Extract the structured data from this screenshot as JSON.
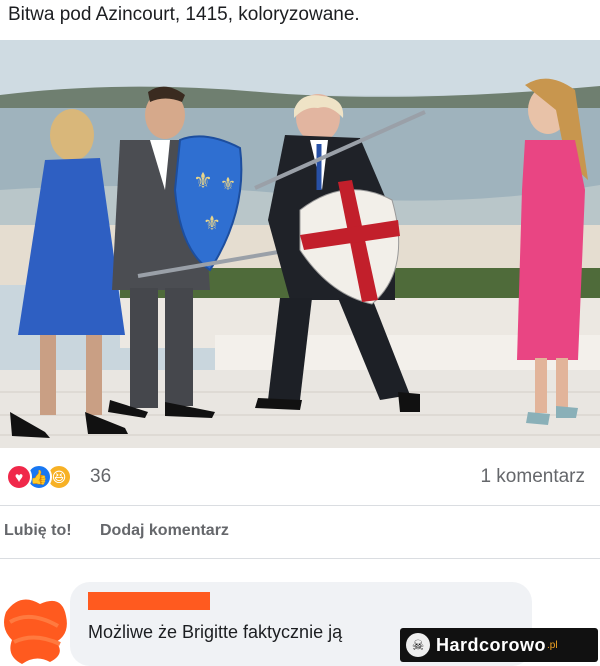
{
  "post": {
    "title": "Bitwa pod Azincourt, 1415, koloryzowane."
  },
  "reactions": {
    "icons": [
      "love-reaction-icon",
      "like-reaction-icon",
      "haha-reaction-icon"
    ],
    "count": "36",
    "comments_label": "1 komentarz"
  },
  "actions": {
    "like_label": "Lubię to!",
    "comment_label": "Dodaj komentarz"
  },
  "comment": {
    "text": "Możliwe że Brigitte faktycznie ją"
  },
  "watermark": {
    "brand": "Hardcorowo",
    "tld": ".pl"
  },
  "colors": {
    "love": "#f0284a",
    "like": "#1877f2",
    "haha": "#f7b125",
    "redaction": "#ff5a1f"
  }
}
